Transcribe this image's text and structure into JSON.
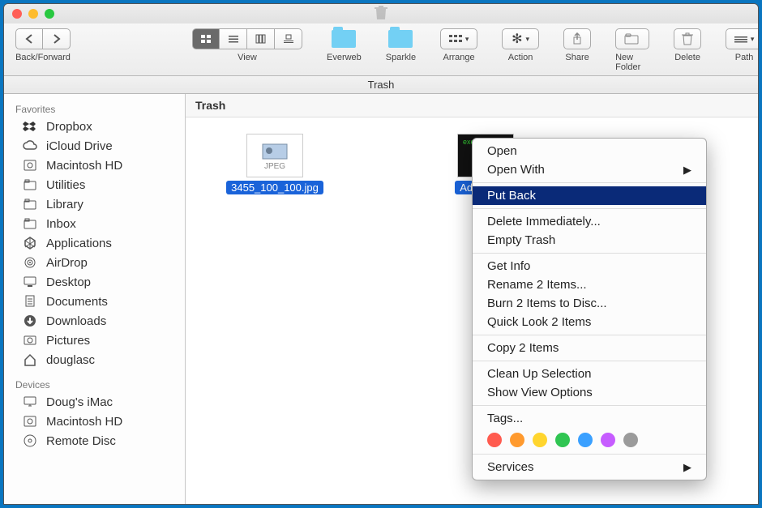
{
  "titlebar": {
    "title_icon": "trash-icon"
  },
  "toolbar": {
    "back_forward_label": "Back/Forward",
    "view_label": "View",
    "everweb_label": "Everweb",
    "sparkle_label": "Sparkle",
    "arrange_label": "Arrange",
    "action_label": "Action",
    "share_label": "Share",
    "newfolder_label": "New Folder",
    "delete_label": "Delete",
    "path_label": "Path"
  },
  "location": "Trash",
  "pane_title": "Trash",
  "sidebar": {
    "favorites_header": "Favorites",
    "favorites": [
      {
        "icon": "dropbox-icon",
        "label": "Dropbox"
      },
      {
        "icon": "cloud-icon",
        "label": "iCloud Drive"
      },
      {
        "icon": "disk-icon",
        "label": "Macintosh HD"
      },
      {
        "icon": "folder-icon",
        "label": "Utilities"
      },
      {
        "icon": "folder-icon",
        "label": "Library"
      },
      {
        "icon": "folder-icon",
        "label": "Inbox"
      },
      {
        "icon": "apps-icon",
        "label": "Applications"
      },
      {
        "icon": "airdrop-icon",
        "label": "AirDrop"
      },
      {
        "icon": "desktop-icon",
        "label": "Desktop"
      },
      {
        "icon": "documents-icon",
        "label": "Documents"
      },
      {
        "icon": "downloads-icon",
        "label": "Downloads"
      },
      {
        "icon": "pictures-icon",
        "label": "Pictures"
      },
      {
        "icon": "home-icon",
        "label": "douglasc"
      }
    ],
    "devices_header": "Devices",
    "devices": [
      {
        "icon": "imac-icon",
        "label": "Doug's iMac"
      },
      {
        "icon": "disk-icon",
        "label": "Macintosh HD"
      },
      {
        "icon": "disc-icon",
        "label": "Remote Disc"
      }
    ]
  },
  "files": [
    {
      "name": "3455_100_100.jpg",
      "type": "jpeg",
      "badge": "JPEG"
    },
    {
      "name": "AddressBo",
      "type": "exec",
      "badge": "exec"
    }
  ],
  "context_menu": {
    "items": [
      {
        "label": "Open",
        "kind": "item"
      },
      {
        "label": "Open With",
        "kind": "submenu"
      },
      {
        "kind": "sep"
      },
      {
        "label": "Put Back",
        "kind": "item",
        "highlight": true
      },
      {
        "kind": "sep"
      },
      {
        "label": "Delete Immediately...",
        "kind": "item"
      },
      {
        "label": "Empty Trash",
        "kind": "item"
      },
      {
        "kind": "sep"
      },
      {
        "label": "Get Info",
        "kind": "item"
      },
      {
        "label": "Rename 2 Items...",
        "kind": "item"
      },
      {
        "label": "Burn 2 Items to Disc...",
        "kind": "item"
      },
      {
        "label": "Quick Look 2 Items",
        "kind": "item"
      },
      {
        "kind": "sep"
      },
      {
        "label": "Copy 2 Items",
        "kind": "item"
      },
      {
        "kind": "sep"
      },
      {
        "label": "Clean Up Selection",
        "kind": "item"
      },
      {
        "label": "Show View Options",
        "kind": "item"
      },
      {
        "kind": "sep"
      },
      {
        "label": "Tags...",
        "kind": "item"
      },
      {
        "kind": "tags"
      },
      {
        "kind": "sep"
      },
      {
        "label": "Services",
        "kind": "submenu"
      }
    ],
    "tag_colors": [
      "#ff5b4f",
      "#ff9a2e",
      "#ffd52e",
      "#30c552",
      "#3aa0ff",
      "#c65cff",
      "#9b9b9b"
    ]
  }
}
